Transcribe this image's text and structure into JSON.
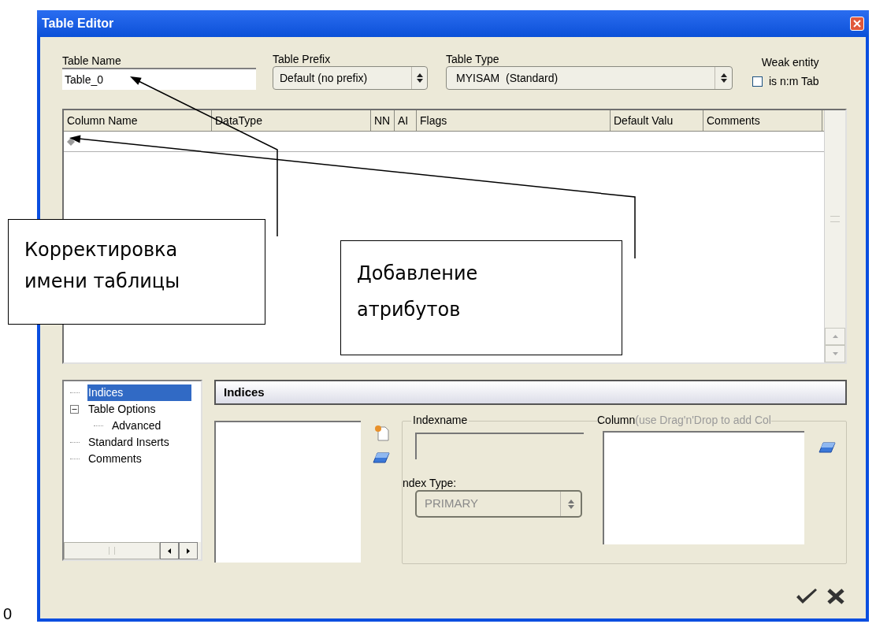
{
  "window": {
    "title": "Table Editor"
  },
  "table_name": {
    "label": "Table Name",
    "value": "Table_0"
  },
  "table_prefix": {
    "label": "Table Prefix",
    "value": "Default (no prefix)"
  },
  "table_type": {
    "label": "Table Type",
    "value": "MYISAM  (Standard)"
  },
  "weak_entity": {
    "label": "Weak entity",
    "checkbox_label": "is n:m Tab",
    "checked": false
  },
  "columns_table": {
    "columns": [
      "Column Name",
      "DataType",
      "NN",
      "AI",
      "Flags",
      "Default Valu",
      "Comments"
    ]
  },
  "tree": {
    "items": [
      {
        "label": "Indices",
        "selected": true
      },
      {
        "label": "Table Options",
        "selected": false,
        "expanded": true,
        "children": [
          {
            "label": "Advanced",
            "selected": false
          }
        ]
      },
      {
        "label": "Standard Inserts",
        "selected": false
      },
      {
        "label": "Comments",
        "selected": false
      }
    ]
  },
  "indices_panel": {
    "header": "Indices",
    "indexname_label": "Indexname",
    "indexname_disabled": true,
    "index_type_label": "ndex Type:",
    "index_type": {
      "value": "PRIMARY",
      "disabled": true
    },
    "columns_label": "Column",
    "columns_hint": "(use Drag'n'Drop to add Col"
  },
  "callouts": [
    {
      "text": "Корректировка\nимени таблицы"
    },
    {
      "text": "Добавление\nатрибутов"
    }
  ],
  "slide_mark": "0"
}
